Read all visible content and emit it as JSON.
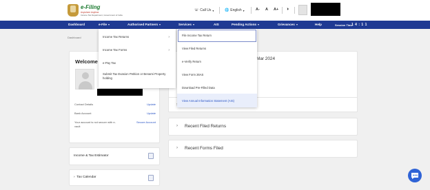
{
  "header": {
    "logo_title": "e-Filing",
    "logo_line1": "Anywhere Anytime",
    "logo_line2": "Income Tax Department, Government of India",
    "call_us": "Call Us",
    "language": "English",
    "font_small": "A-",
    "font_normal": "A",
    "font_large": "A+",
    "contrast": "◑"
  },
  "nav": {
    "items": [
      "Dashboard",
      "e-File",
      "Authorised Partners",
      "Services",
      "AIS",
      "Pending Actions",
      "Grievances",
      "Help"
    ],
    "session_label": "Session Time",
    "session_value": "1 4 : 1 1"
  },
  "breadcrumb": "Dashboard",
  "profile": {
    "welcome": "Welcome B",
    "rows": [
      {
        "label": "Contact Details",
        "link": "Update"
      },
      {
        "label": "Bank Account",
        "link": "Update"
      },
      {
        "label": "Your account is not secure with e-vault",
        "link": "Secure Account"
      }
    ]
  },
  "left_cards": {
    "tax_estimator": "Income & Tax Estimator",
    "tax_calendar": "Tax Calendar"
  },
  "main": {
    "filing_partial": "Mar 2024",
    "recent_filed_returns": "Recent Filed Returns",
    "recent_forms_filed": "Recent Forms Filed"
  },
  "efile_menu": {
    "items": [
      "Income Tax Returns",
      "Income Tax Forms",
      "e-Pay Tax",
      "Submit Tax Evasion Petition or Benami Property holding"
    ]
  },
  "services_menu": {
    "items": [
      "File Income Tax Return",
      "View Filed Returns",
      "e-Verify Return",
      "View Form 26AS",
      "Download Pre-Filled Data",
      "View Annual Information Statement (AIS)"
    ]
  }
}
